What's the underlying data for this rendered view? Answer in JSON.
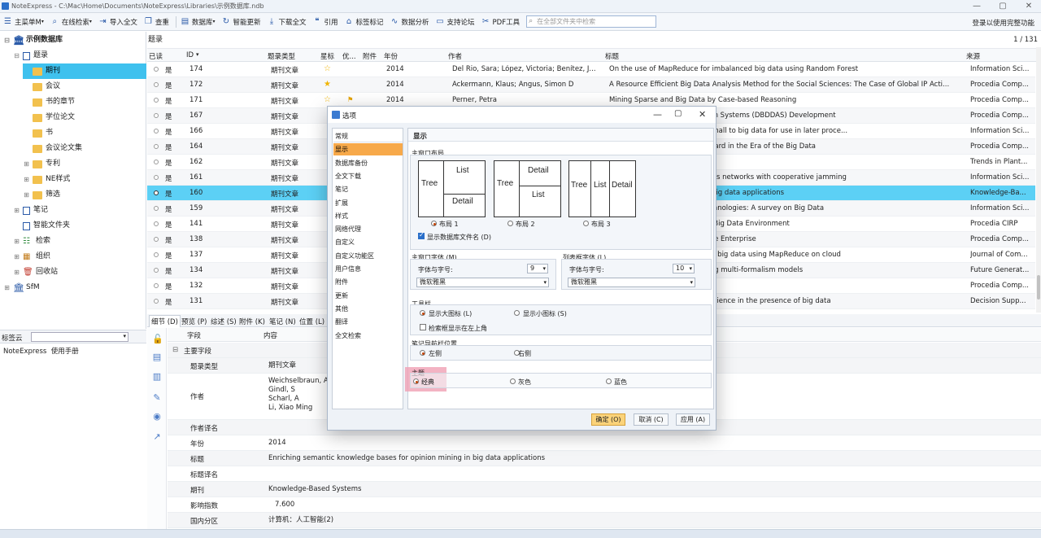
{
  "window": {
    "title": "NoteExpress - C:\\Mac\\Home\\Documents\\NoteExpress\\Libraries\\示例数据库.ndb"
  },
  "toolbar": {
    "items": [
      "主菜单M",
      "在线检索",
      "导入全文",
      "查重",
      "数据库",
      "智能更新",
      "下载全文",
      "引用",
      "标签标记",
      "数据分析",
      "支持论坛",
      "PDF工具"
    ],
    "search_placeholder": "在全部文件夹中检索",
    "login": "登录以使用完整功能"
  },
  "tree": {
    "root": "示例数据库",
    "nodes": [
      {
        "label": "题录"
      },
      {
        "label": "期刊"
      },
      {
        "label": "会议"
      },
      {
        "label": "书的章节"
      },
      {
        "label": "学位论文"
      },
      {
        "label": "书"
      },
      {
        "label": "会议论文集"
      },
      {
        "label": "专利"
      },
      {
        "label": "NE样式"
      },
      {
        "label": "筛选"
      },
      {
        "label": "笔记"
      },
      {
        "label": "智能文件夹"
      },
      {
        "label": "检索"
      },
      {
        "label": "组织"
      },
      {
        "label": "回收站"
      }
    ],
    "root2": "SfM"
  },
  "tagcloud": {
    "label": "标签云",
    "items": [
      "NoteExpress",
      "使用手册"
    ]
  },
  "grid": {
    "title": "题录",
    "page": "1 / 131",
    "columns": [
      "已读",
      "ID",
      "题录类型",
      "星标",
      "优...",
      "附件",
      "年份",
      "作者",
      "标题",
      "来源"
    ],
    "rows": [
      {
        "read": "是",
        "id": "174",
        "type": "期刊文章",
        "star": "☆",
        "flag": "",
        "year": "2014",
        "author": "Del Rio, Sara; López, Victoria; Benítez, J...",
        "title": "On the use of MapReduce for imbalanced big data using Random Forest",
        "source": "Information Sci..."
      },
      {
        "read": "是",
        "id": "172",
        "type": "期刊文章",
        "star": "★",
        "flag": "",
        "year": "2014",
        "author": "Ackermann, Klaus; Angus, Simon D",
        "title": "A Resource Efficient Big Data Analysis Method for the Social Sciences: The Case of Global IP Acti...",
        "source": "Procedia Comp..."
      },
      {
        "read": "是",
        "id": "171",
        "type": "期刊文章",
        "star": "☆",
        "flag": "⚑",
        "year": "2014",
        "author": "Perner, Petra",
        "title": "Mining Sparse and Big Data by Case-based Reasoning",
        "source": "Procedia Comp..."
      },
      {
        "read": "是",
        "id": "167",
        "type": "期刊文章",
        "star": "",
        "flag": "",
        "year": "",
        "author": "",
        "title": "mic Big-data-driven Application Systems (DBDDAS) Development",
        "source": "Procedia Comp..."
      },
      {
        "read": "是",
        "id": "166",
        "type": "期刊文章",
        "star": "",
        "flag": "",
        "year": "",
        "author": "",
        "title": "nbinations of variables from small to big data for use in later proce...",
        "source": "Information Sci..."
      },
      {
        "read": "是",
        "id": "164",
        "type": "期刊文章",
        "star": "",
        "flag": "",
        "year": "",
        "author": "",
        "title": "ncial Data Classification Standard in the Era of the Big Data",
        "source": "Procedia Comp..."
      },
      {
        "read": "是",
        "id": "162",
        "type": "期刊文章",
        "star": "",
        "flag": "",
        "year": "",
        "author": "",
        "title": "-data world",
        "source": "Trends in Plant..."
      },
      {
        "read": "是",
        "id": "161",
        "type": "期刊文章",
        "star": "",
        "flag": "",
        "year": "",
        "author": "",
        "title": "ure big data in two-hop wireless networks with cooperative jamming",
        "source": "Information Sci..."
      },
      {
        "read": "是",
        "id": "160",
        "type": "期刊文章",
        "star": "",
        "flag": "",
        "year": "",
        "author": "",
        "title": "e bases for opinion mining in big data applications",
        "source": "Knowledge-Ba..."
      },
      {
        "read": "是",
        "id": "159",
        "type": "期刊文章",
        "star": "",
        "flag": "",
        "year": "",
        "author": "",
        "title": "hallenges, techniques and technologies: A survey on Big Data",
        "source": "Information Sci..."
      },
      {
        "read": "是",
        "id": "141",
        "type": "期刊文章",
        "star": "",
        "flag": "",
        "year": "",
        "author": "",
        "title": "Analytics for Industry 4.0 and Big Data Environment",
        "source": "Procedia CIRP"
      },
      {
        "read": "是",
        "id": "138",
        "type": "期刊文章",
        "star": "",
        "flag": "",
        "year": "",
        "author": "",
        "title": "Big Data in Chinese Real Estate Enterprise",
        "source": "Procedia Comp..."
      },
      {
        "read": "是",
        "id": "137",
        "type": "期刊文章",
        "star": "",
        "flag": "",
        "year": "",
        "author": "",
        "title": "e sub-tree anonymization over big data using MapReduce on cloud",
        "source": "Journal of Com..."
      },
      {
        "read": "是",
        "id": "134",
        "type": "期刊文章",
        "star": "",
        "flag": "",
        "year": "",
        "author": "",
        "title": "SQL big-data applications using multi-formalism models",
        "source": "Future Generat..."
      },
      {
        "read": "是",
        "id": "132",
        "type": "期刊文章",
        "star": "",
        "flag": "",
        "year": "",
        "author": "",
        "title": "a Science",
        "source": "Procedia Comp..."
      },
      {
        "read": "是",
        "id": "131",
        "type": "期刊文章",
        "star": "",
        "flag": "",
        "year": "",
        "author": "",
        "title": "shift to computational social science in the presence of big data",
        "source": "Decision Supp..."
      }
    ]
  },
  "detail": {
    "tabs": [
      "细节 (D)",
      "预览 (P)",
      "综述 (S)",
      "附件 (K)",
      "笔记 (N)",
      "位置 (L)"
    ],
    "head": {
      "field": "字段",
      "content": "内容"
    },
    "group": "主要字段",
    "fields": [
      {
        "k": "题录类型",
        "v": "期刊文章"
      },
      {
        "k": "作者",
        "v": "Weichselbraun, A\nGindl, S\nScharl, A\nLi, Xiao Ming"
      },
      {
        "k": "作者译名",
        "v": ""
      },
      {
        "k": "年份",
        "v": "2014"
      },
      {
        "k": "标题",
        "v": "Enriching semantic knowledge bases for opinion mining in big data applications"
      },
      {
        "k": "标题译名",
        "v": ""
      },
      {
        "k": "期刊",
        "v": "Knowledge-Based Systems"
      },
      {
        "k": "影响指数",
        "v": "7.600"
      },
      {
        "k": "国内分区",
        "v": "计算机：人工智能(2)"
      }
    ]
  },
  "dialog": {
    "title": "选项",
    "categories": [
      "常规",
      "显示",
      "数据库备份",
      "全文下载",
      "笔记",
      "扩展",
      "样式",
      "网络代理",
      "自定义",
      "自定义功能区",
      "用户信息",
      "附件",
      "更新",
      "其他",
      "翻译",
      "全文检索"
    ],
    "panel_title": "显示",
    "layout_section": "主窗口布局",
    "layouts": [
      {
        "label": "布局 1",
        "a": "Tree",
        "b": "List",
        "c": "Detail"
      },
      {
        "label": "布局 2",
        "a": "Tree",
        "b": "Detail",
        "c": "List"
      },
      {
        "label": "布局 3",
        "a": "Tree",
        "b": "List",
        "c": "Detail"
      }
    ],
    "show_dbname": "显示数据库文件名 (D)",
    "mainfont_section": "主窗口字体 (M)",
    "listfont_section": "列表框字体 (L)",
    "font_label": "字体与字号:",
    "main_size": "9",
    "list_size": "10",
    "main_font": "微软雅黑",
    "list_font": "微软雅黑",
    "toolbar_section": "工具栏",
    "big_icons": "显示大图标 (L)",
    "small_icons": "显示小图标 (S)",
    "search_topleft": "检索框显示在左上角",
    "notenav_section": "笔记导航栏位置",
    "left": "左侧",
    "right": "右侧",
    "theme_section": "主题",
    "themes": [
      "经典",
      "灰色",
      "蓝色"
    ],
    "buttons": {
      "ok": "确定 (O)",
      "cancel": "取消 (C)",
      "apply": "应用 (A)"
    }
  }
}
